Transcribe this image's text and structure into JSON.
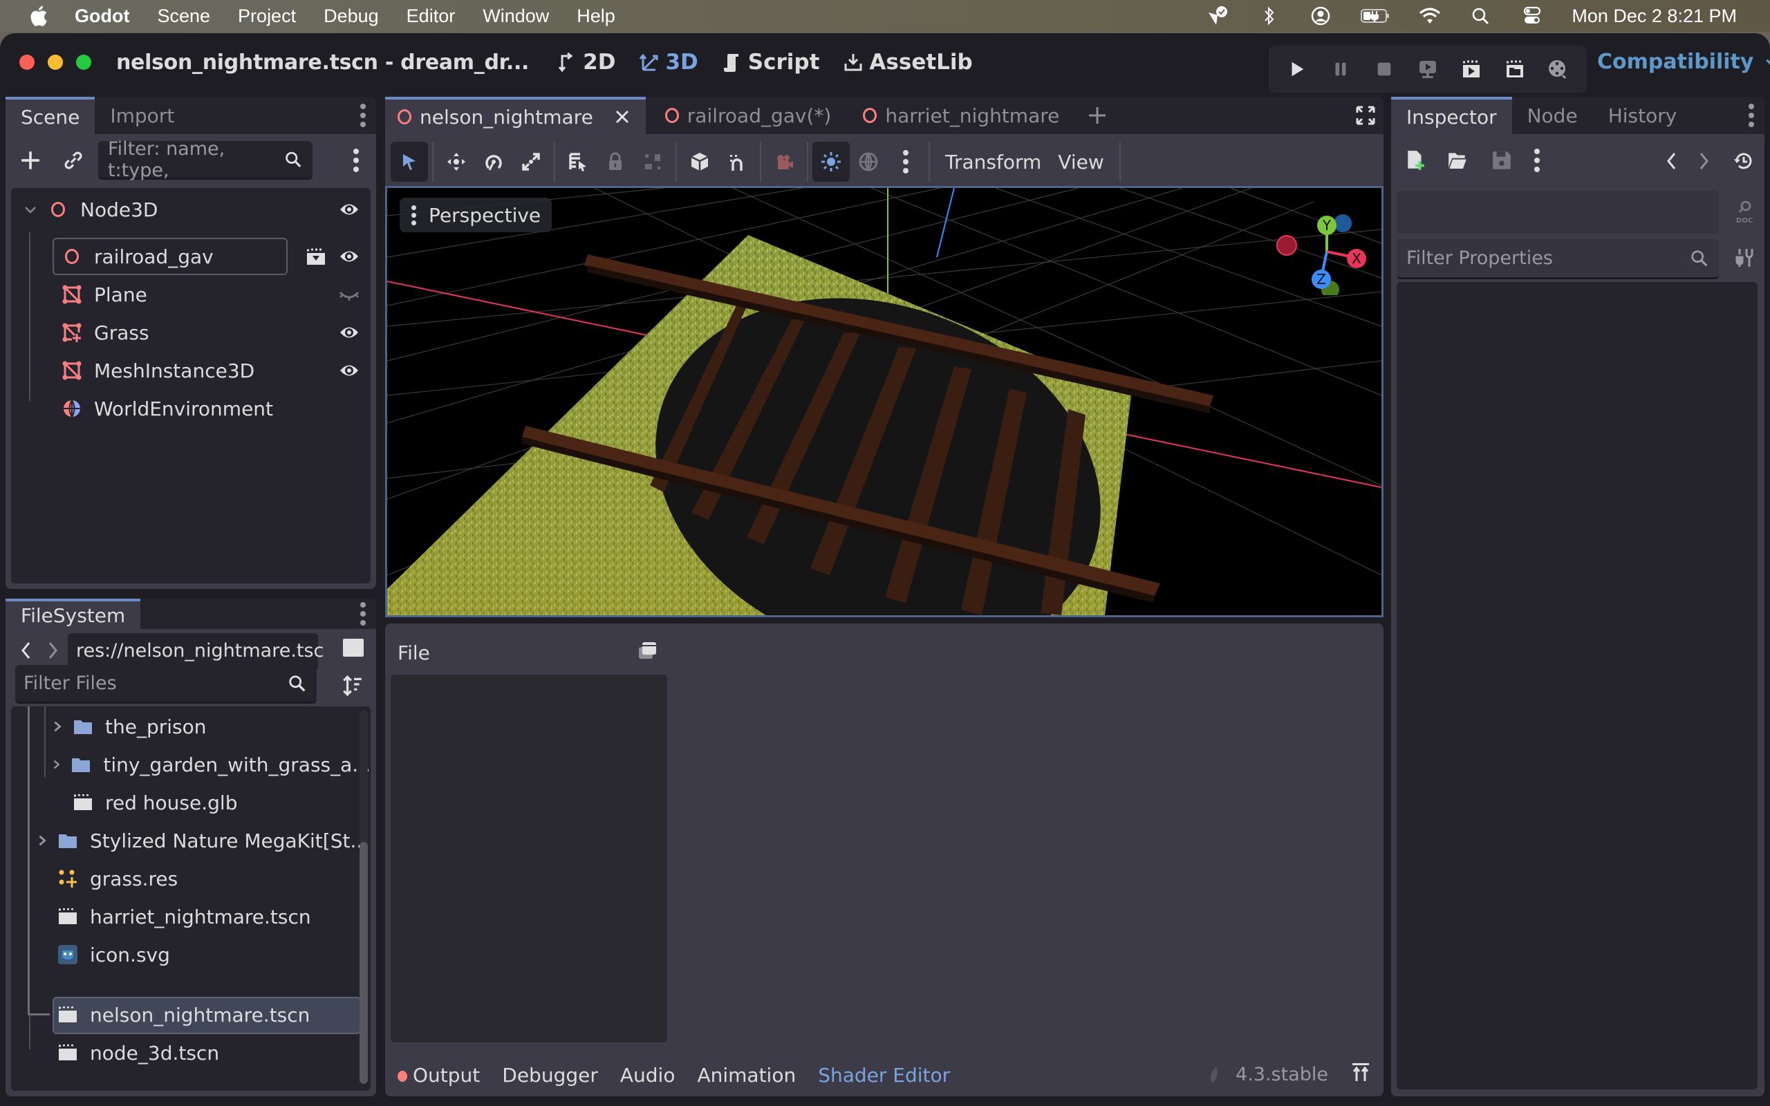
{
  "menubar": {
    "items": [
      "Godot",
      "Scene",
      "Project",
      "Debug",
      "Editor",
      "Window",
      "Help"
    ],
    "clock": "Mon Dec 2  8:21 PM",
    "status_icons": [
      "vpn-check-icon",
      "bluetooth-icon",
      "user-icon",
      "battery-charging-icon",
      "wifi-icon",
      "spotlight-search-icon",
      "control-center-icon"
    ]
  },
  "window": {
    "title": "nelson_nightmare.tscn - dream_dr...",
    "main_screens": [
      {
        "label": "2D",
        "icon": "2d-icon",
        "active": false
      },
      {
        "label": "3D",
        "icon": "3d-icon",
        "active": true
      },
      {
        "label": "Script",
        "icon": "script-icon",
        "active": false
      },
      {
        "label": "AssetLib",
        "icon": "assetlib-icon",
        "active": false
      }
    ],
    "run_buttons": [
      "play-icon",
      "pause-icon",
      "stop-icon",
      "remote-debug-icon",
      "play-scene-icon",
      "play-custom-scene-icon",
      "movie-maker-icon"
    ],
    "renderer": "Compatibility"
  },
  "scene_dock": {
    "tabs": [
      "Scene",
      "Import"
    ],
    "active_tab": "Scene",
    "filter_placeholder": "Filter: name, t:type,",
    "nodes": [
      {
        "name": "Node3D",
        "type": "node3d",
        "depth": 0,
        "visible": true,
        "expanded": true
      },
      {
        "name": "railroad_gav",
        "type": "node3d",
        "depth": 1,
        "visible": true,
        "instanced_scene": true,
        "selected": true
      },
      {
        "name": "Plane",
        "type": "mesh",
        "depth": 1,
        "visible": false
      },
      {
        "name": "Grass",
        "type": "multimesh",
        "depth": 1,
        "visible": true
      },
      {
        "name": "MeshInstance3D",
        "type": "mesh",
        "depth": 1,
        "visible": true
      },
      {
        "name": "WorldEnvironment",
        "type": "environment",
        "depth": 1
      }
    ]
  },
  "filesystem_dock": {
    "tab": "FileSystem",
    "path": "res://nelson_nightmare.tsc",
    "filter_placeholder": "Filter Files",
    "items": [
      {
        "name": "the_prison",
        "kind": "folder",
        "depth": 2
      },
      {
        "name": "tiny_garden_with_grass_a...",
        "kind": "folder",
        "depth": 2
      },
      {
        "name": "red house.glb",
        "kind": "scene",
        "depth": 2
      },
      {
        "name": "Stylized Nature MegaKit[St...",
        "kind": "folder",
        "depth": 1
      },
      {
        "name": "grass.res",
        "kind": "resource",
        "depth": 1
      },
      {
        "name": "harriet_nightmare.tscn",
        "kind": "scene",
        "depth": 1
      },
      {
        "name": "icon.svg",
        "kind": "image",
        "depth": 1
      },
      {
        "name": "nelson_nightmare.tscn",
        "kind": "scene",
        "depth": 1,
        "selected": true
      },
      {
        "name": "node_3d.tscn",
        "kind": "scene",
        "depth": 1
      }
    ]
  },
  "editor": {
    "scene_tabs": [
      {
        "label": "nelson_nightmare",
        "active": true,
        "closable": true
      },
      {
        "label": "railroad_gav(*)",
        "active": false
      },
      {
        "label": "harriet_nightmare",
        "active": false
      }
    ],
    "toolbar_menus": [
      "Transform",
      "View"
    ],
    "viewport_label": "Perspective",
    "gizmo_axes": [
      "Y",
      "X",
      "Z"
    ]
  },
  "bottom_panel": {
    "file_menu": "File",
    "tabs": [
      "Output",
      "Debugger",
      "Audio",
      "Animation",
      "Shader Editor"
    ],
    "active_tab": "Shader Editor",
    "version": "4.3.stable"
  },
  "inspector_dock": {
    "tabs": [
      "Inspector",
      "Node",
      "History"
    ],
    "active_tab": "Inspector",
    "filter_placeholder": "Filter Properties"
  },
  "colors": {
    "accent": "#6d8bc2",
    "node3d": "#fc7f7f",
    "renderer": "#5e99c9",
    "active_bottom_tab": "#7aa3e0"
  }
}
